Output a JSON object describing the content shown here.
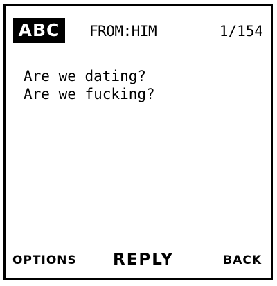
{
  "header": {
    "mode": "ABC",
    "from": "FROM:HIM",
    "counter": "1/154"
  },
  "message": {
    "lines": [
      "Are we dating?",
      "Are we fucking?"
    ]
  },
  "softkeys": {
    "left": "OPTIONS",
    "center": "REPLY",
    "right": "BACK"
  }
}
